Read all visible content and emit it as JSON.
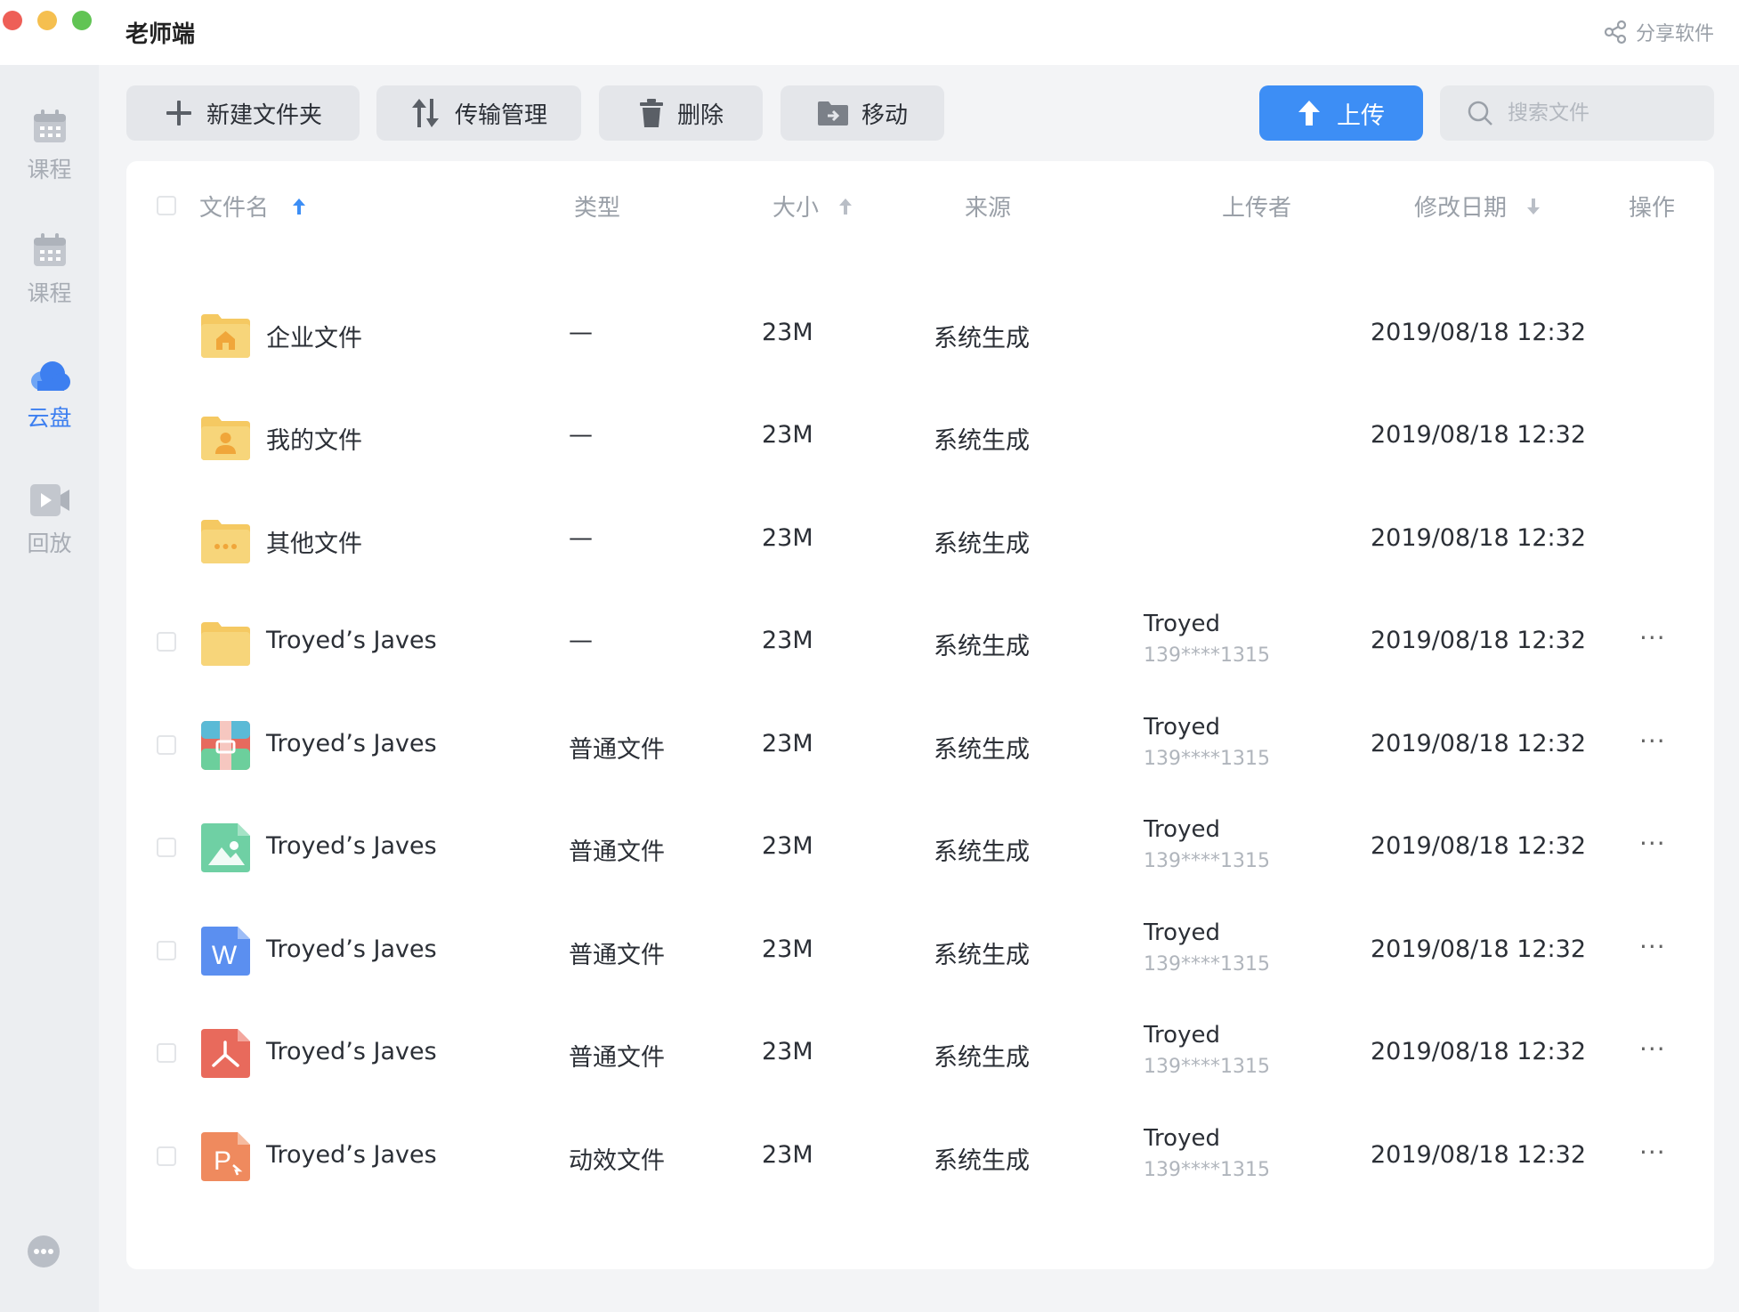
{
  "app": {
    "title": "老师端",
    "share_label": "分享软件"
  },
  "sidebar": {
    "items": [
      {
        "label": "课程",
        "icon": "calendar-icon"
      },
      {
        "label": "课程",
        "icon": "calendar-icon"
      },
      {
        "label": "云盘",
        "icon": "cloud-icon",
        "active": true
      },
      {
        "label": "回放",
        "icon": "video-icon"
      }
    ]
  },
  "toolbar": {
    "new_folder": "新建文件夹",
    "transfer": "传输管理",
    "delete": "删除",
    "move": "移动",
    "upload": "上传",
    "search_placeholder": "搜索文件"
  },
  "table": {
    "headers": {
      "name": "文件名",
      "type": "类型",
      "size": "大小",
      "source": "来源",
      "uploader": "上传者",
      "date": "修改日期",
      "action": "操作"
    },
    "rows": [
      {
        "icon": "enterprise-folder-icon",
        "name": "企业文件",
        "type": "—",
        "size": "23M",
        "source": "系统生成",
        "uploader": "",
        "phone": "",
        "date": "2019/08/18 12:32",
        "checkbox": false,
        "more": ""
      },
      {
        "icon": "personal-folder-icon",
        "name": "我的文件",
        "type": "—",
        "size": "23M",
        "source": "系统生成",
        "uploader": "",
        "phone": "",
        "date": "2019/08/18 12:32",
        "checkbox": false,
        "more": ""
      },
      {
        "icon": "other-folder-icon",
        "name": "其他文件",
        "type": "—",
        "size": "23M",
        "source": "系统生成",
        "uploader": "",
        "phone": "",
        "date": "2019/08/18 12:32",
        "checkbox": false,
        "more": ""
      },
      {
        "icon": "folder-icon",
        "name": "Troyed’s Javes",
        "type": "—",
        "size": "23M",
        "source": "系统生成",
        "uploader": "Troyed",
        "phone": "139****1315",
        "date": "2019/08/18 12:32",
        "checkbox": true,
        "more": "···"
      },
      {
        "icon": "archive-file-icon",
        "name": "Troyed’s Javes",
        "type": "普通文件",
        "size": "23M",
        "source": "系统生成",
        "uploader": "Troyed",
        "phone": "139****1315",
        "date": "2019/08/18 12:32",
        "checkbox": true,
        "more": "···"
      },
      {
        "icon": "image-file-icon",
        "name": "Troyed’s Javes",
        "type": "普通文件",
        "size": "23M",
        "source": "系统生成",
        "uploader": "Troyed",
        "phone": "139****1315",
        "date": "2019/08/18 12:32",
        "checkbox": true,
        "more": "···"
      },
      {
        "icon": "word-file-icon",
        "name": "Troyed’s Javes",
        "type": "普通文件",
        "size": "23M",
        "source": "系统生成",
        "uploader": "Troyed",
        "phone": "139****1315",
        "date": "2019/08/18 12:32",
        "checkbox": true,
        "more": "···"
      },
      {
        "icon": "pdf-file-icon",
        "name": "Troyed’s Javes",
        "type": "普通文件",
        "size": "23M",
        "source": "系统生成",
        "uploader": "Troyed",
        "phone": "139****1315",
        "date": "2019/08/18 12:32",
        "checkbox": true,
        "more": "···"
      },
      {
        "icon": "ppt-file-icon",
        "name": "Troyed’s Javes",
        "type": "动效文件",
        "size": "23M",
        "source": "系统生成",
        "uploader": "Troyed",
        "phone": "139****1315",
        "date": "2019/08/18 12:32",
        "checkbox": true,
        "more": "···"
      }
    ]
  },
  "colors": {
    "accent": "#3d8ef5",
    "folder": "#f7d57a",
    "word": "#5b8ff0",
    "pdf": "#e86a5c",
    "ppt": "#ef8a5e",
    "image": "#6fd0a4"
  }
}
